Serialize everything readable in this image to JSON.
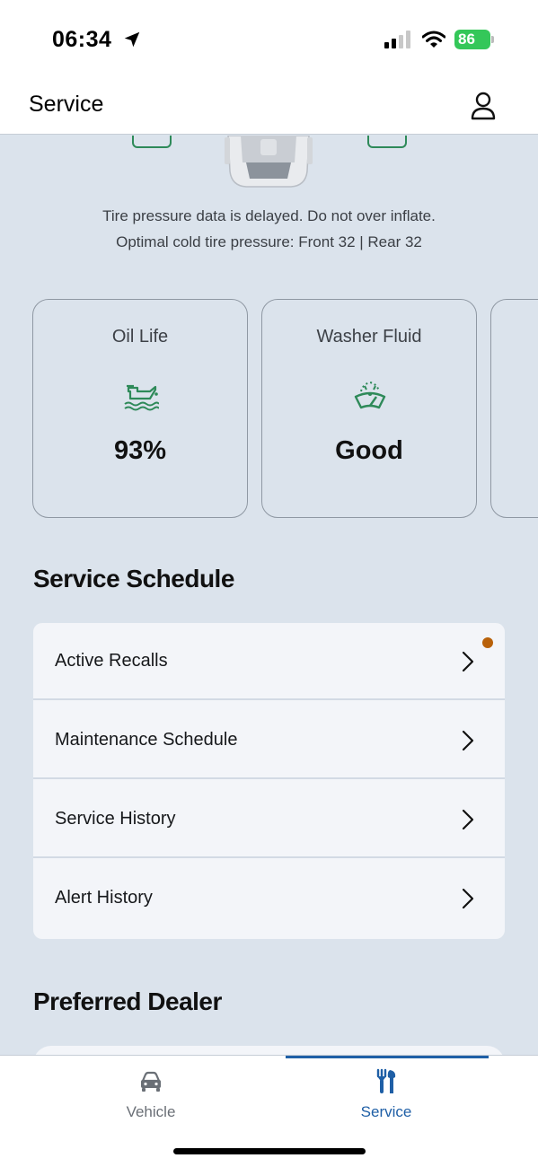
{
  "status_bar": {
    "time": "06:34",
    "battery": "86",
    "icons": [
      "location-arrow-icon",
      "cellular-signal-icon",
      "wifi-icon",
      "battery-charging-icon"
    ]
  },
  "header": {
    "title": "Service",
    "account_icon": "person-icon"
  },
  "tire_section": {
    "note_line_1": "Tire pressure data is delayed. Do not over inflate.",
    "note_line_2": "Optimal cold tire pressure: Front 32 | Rear 32"
  },
  "status_cards": [
    {
      "label": "Oil Life",
      "value": "93%",
      "icon": "oil-can-icon"
    },
    {
      "label": "Washer Fluid",
      "value": "Good",
      "icon": "windshield-washer-icon"
    }
  ],
  "service_schedule": {
    "title": "Service Schedule",
    "items": [
      {
        "label": "Active Recalls",
        "has_notification": true
      },
      {
        "label": "Maintenance Schedule"
      },
      {
        "label": "Service History"
      },
      {
        "label": "Alert History"
      }
    ]
  },
  "preferred_dealer": {
    "title": "Preferred Dealer"
  },
  "tab_bar": {
    "tabs": [
      {
        "label": "Vehicle",
        "icon": "car-icon",
        "active": false
      },
      {
        "label": "Service",
        "icon": "tools-icon",
        "active": true
      }
    ]
  },
  "colors": {
    "background": "#dbe3ec",
    "accent_blue": "#1f5fa6",
    "icon_green": "#2e8a59",
    "notification_dot": "#b8610a",
    "battery_green": "#34c759"
  }
}
